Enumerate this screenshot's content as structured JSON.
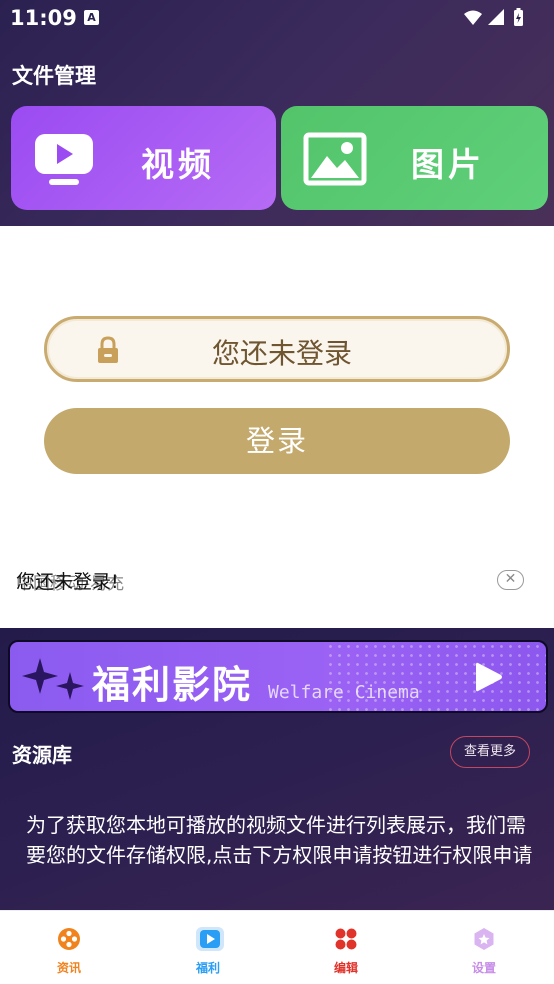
{
  "status_bar": {
    "time": "11:09",
    "notification_glyph": "A"
  },
  "file_management": {
    "title": "文件管理",
    "video_label": "视频",
    "image_label": "图片"
  },
  "login": {
    "status_text": "您还未登录",
    "button_label": "登录"
  },
  "notice": {
    "ghost_text": "中国移动-易充",
    "main_text": "您还未登录!",
    "close_symbol": "✕"
  },
  "welfare": {
    "title": "福利影院",
    "subtitle": "Welfare Cinema"
  },
  "resources": {
    "title": "资源库",
    "see_more": "查看更多",
    "permission_text": "为了获取您本地可播放的视频文件进行列表展示，我们需要您的文件存储权限,点击下方权限申请按钮进行权限申请"
  },
  "bottom_nav": {
    "items": [
      {
        "label": "资讯",
        "color": "#f0831e"
      },
      {
        "label": "福利",
        "color": "#2a9df4"
      },
      {
        "label": "编辑",
        "color": "#e0332a"
      },
      {
        "label": "设置",
        "color": "#c78ee8"
      }
    ]
  },
  "colors": {
    "video_card": "#9b4bf2",
    "image_card": "#53c46a",
    "login_gold": "#c4a96d",
    "dark_bg": "#2b2150"
  }
}
